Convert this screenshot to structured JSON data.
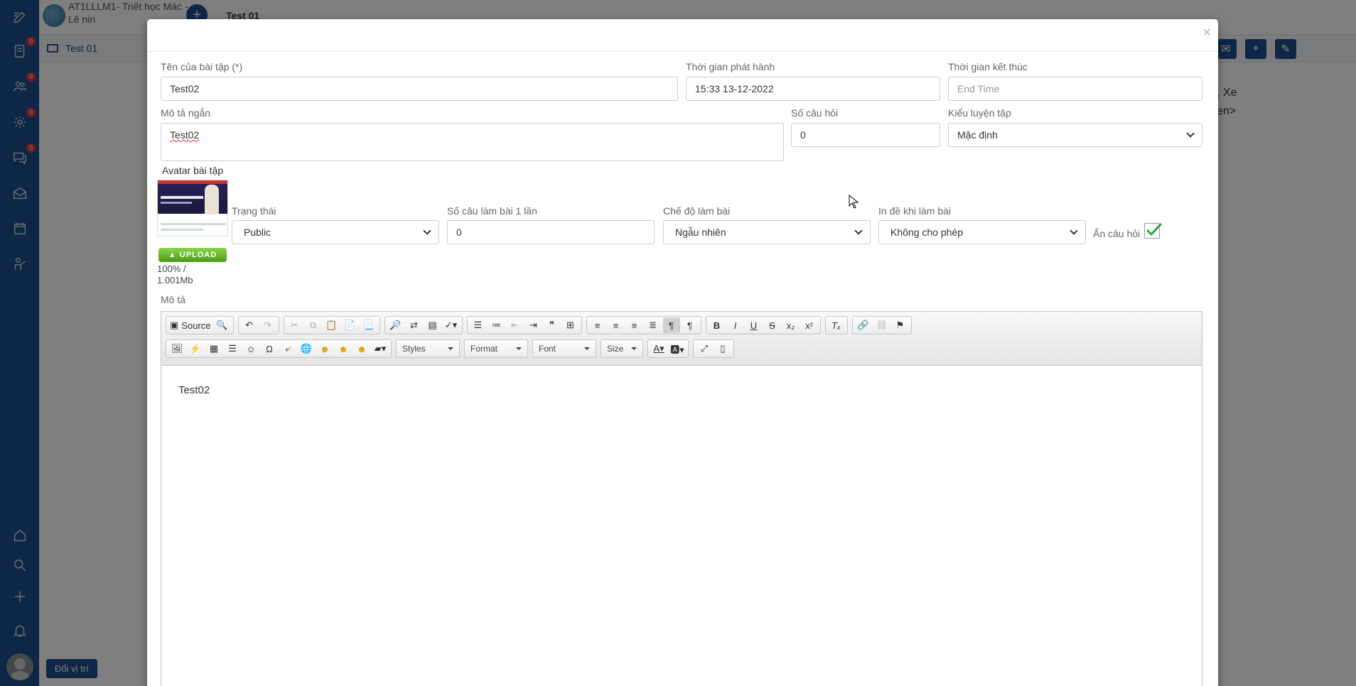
{
  "background": {
    "course_name": "AT1LLLM1- Triết học Mác - Lê nin",
    "page_title": "Test 01",
    "tab_label": "Test 01",
    "side_text_line1": ", Xe",
    "side_text_line2": "en>",
    "change_position_label": "Đổi vị trí",
    "badges": [
      "0",
      "0",
      "0",
      "0"
    ]
  },
  "modal": {
    "close_glyph": "×",
    "fields": {
      "name_label": "Tên của bài tập (*)",
      "name_value": "Test02",
      "release_label": "Thời gian phát hành",
      "release_value": "15:33 13-12-2022",
      "end_label": "Thời gian kết thúc",
      "end_placeholder": "End Time",
      "short_desc_label": "Mô tả ngắn",
      "short_desc_value": "Test02",
      "question_count_label": "Số câu hỏi",
      "question_count_value": "0",
      "practice_type_label": "Kiểu luyện tập",
      "practice_type_value": "Mặc định",
      "avatar_label": "Avatar bài tập",
      "upload_label": "UPLOAD",
      "upload_progress_line1": "100% /",
      "upload_progress_line2": "1.001Mb",
      "status_label": "Trạng thái",
      "status_value": "Public",
      "per_attempt_label": "Số câu làm bài 1 lần",
      "per_attempt_value": "0",
      "mode_label": "Chế độ làm bài",
      "mode_value": "Ngẫu nhiên",
      "print_label": "In đề khi làm bài",
      "print_value": "Không cho phép",
      "hide_question_label": "Ẩn câu hỏi",
      "description_label": "Mô tả"
    },
    "editor": {
      "source_label": "Source",
      "styles_label": "Styles",
      "format_label": "Format",
      "font_label": "Font",
      "size_label": "Size",
      "content": "Test02"
    }
  }
}
